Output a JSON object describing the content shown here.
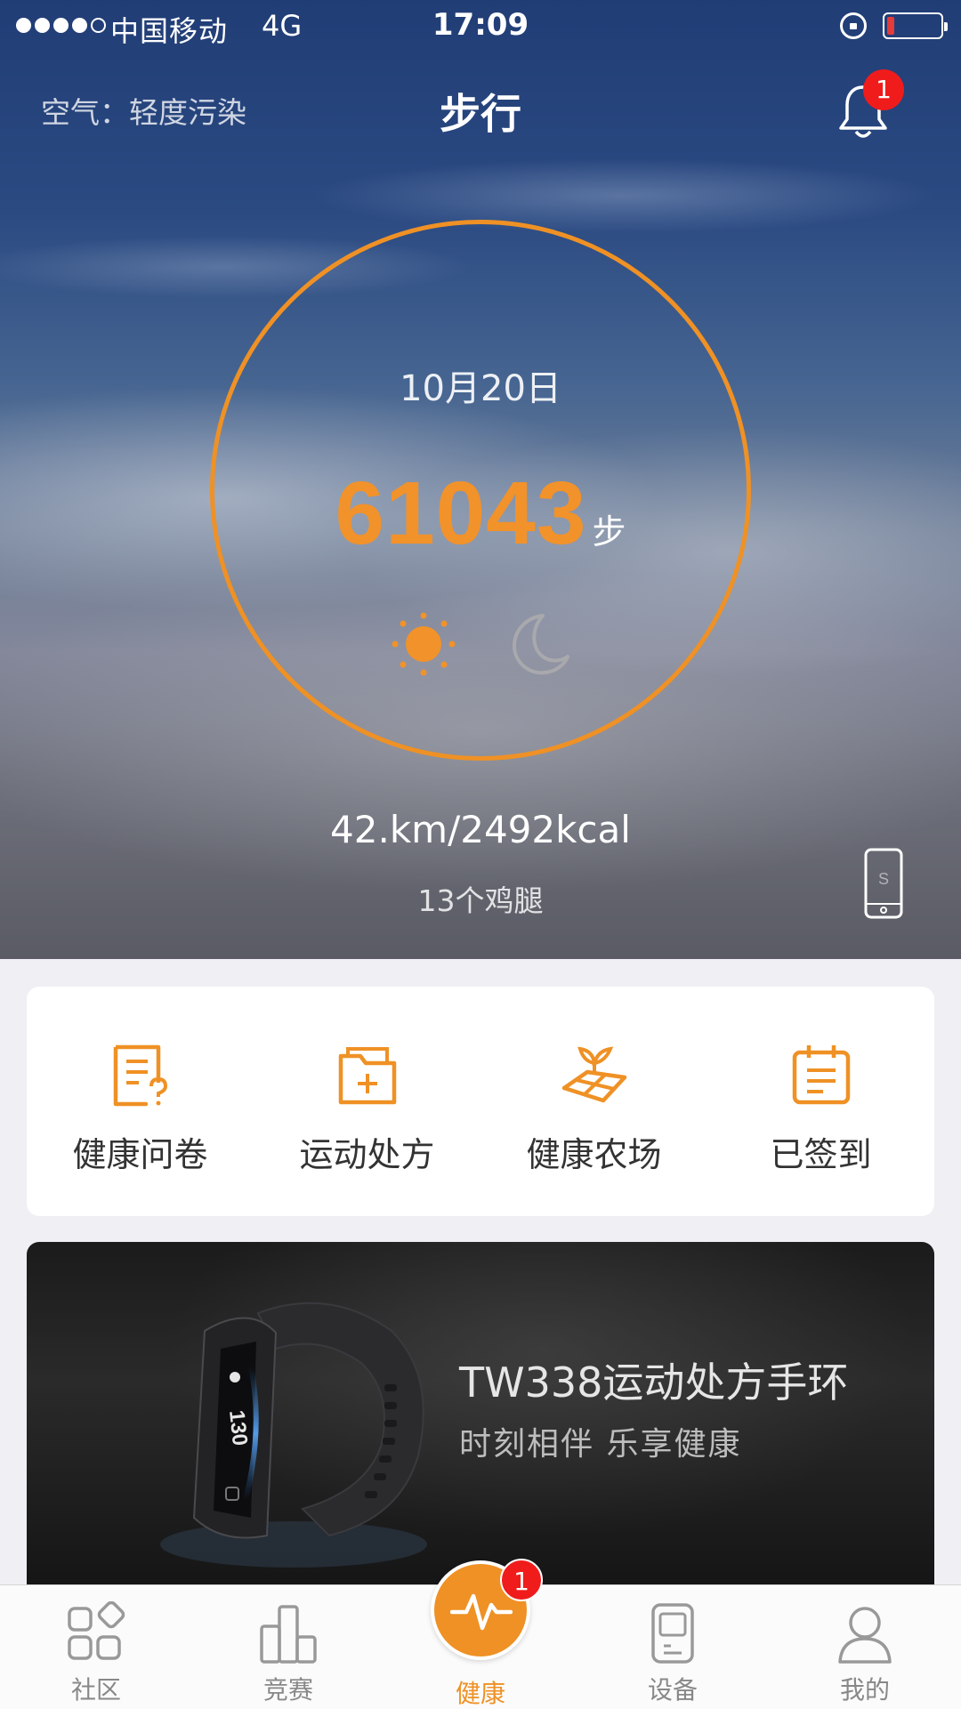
{
  "status_bar": {
    "carrier": "中国移动",
    "network": "4G",
    "time": "17:09",
    "signal_bars": 4,
    "signal_max": 5
  },
  "header": {
    "air_quality": "空气：轻度污染",
    "title": "步行",
    "notification_count": "1"
  },
  "summary": {
    "date": "10月20日",
    "steps": "61043",
    "steps_unit": "步",
    "distance_calories": "42.km/2492kcal",
    "food_equivalent": "13个鸡腿",
    "day_icon": "sun-icon",
    "night_icon": "moon-icon"
  },
  "quick_actions": [
    {
      "label": "健康问卷",
      "icon": "questionnaire-icon"
    },
    {
      "label": "运动处方",
      "icon": "prescription-folder-icon"
    },
    {
      "label": "健康农场",
      "icon": "farm-sprout-icon"
    },
    {
      "label": "已签到",
      "icon": "calendar-checkin-icon"
    }
  ],
  "banner": {
    "title": "TW338运动处方手环",
    "subtitle": "时刻相伴 乐享健康",
    "device_screen_value": "130"
  },
  "tabbar": {
    "items": [
      {
        "label": "社区",
        "icon": "community-icon"
      },
      {
        "label": "竞赛",
        "icon": "competition-icon"
      },
      {
        "label": "健康",
        "icon": "pulse-icon"
      },
      {
        "label": "设备",
        "icon": "device-icon"
      },
      {
        "label": "我的",
        "icon": "profile-icon"
      }
    ],
    "active": "健康",
    "health_badge": "1"
  },
  "colors": {
    "accent": "#ef9125",
    "badge": "#f01c1c"
  }
}
